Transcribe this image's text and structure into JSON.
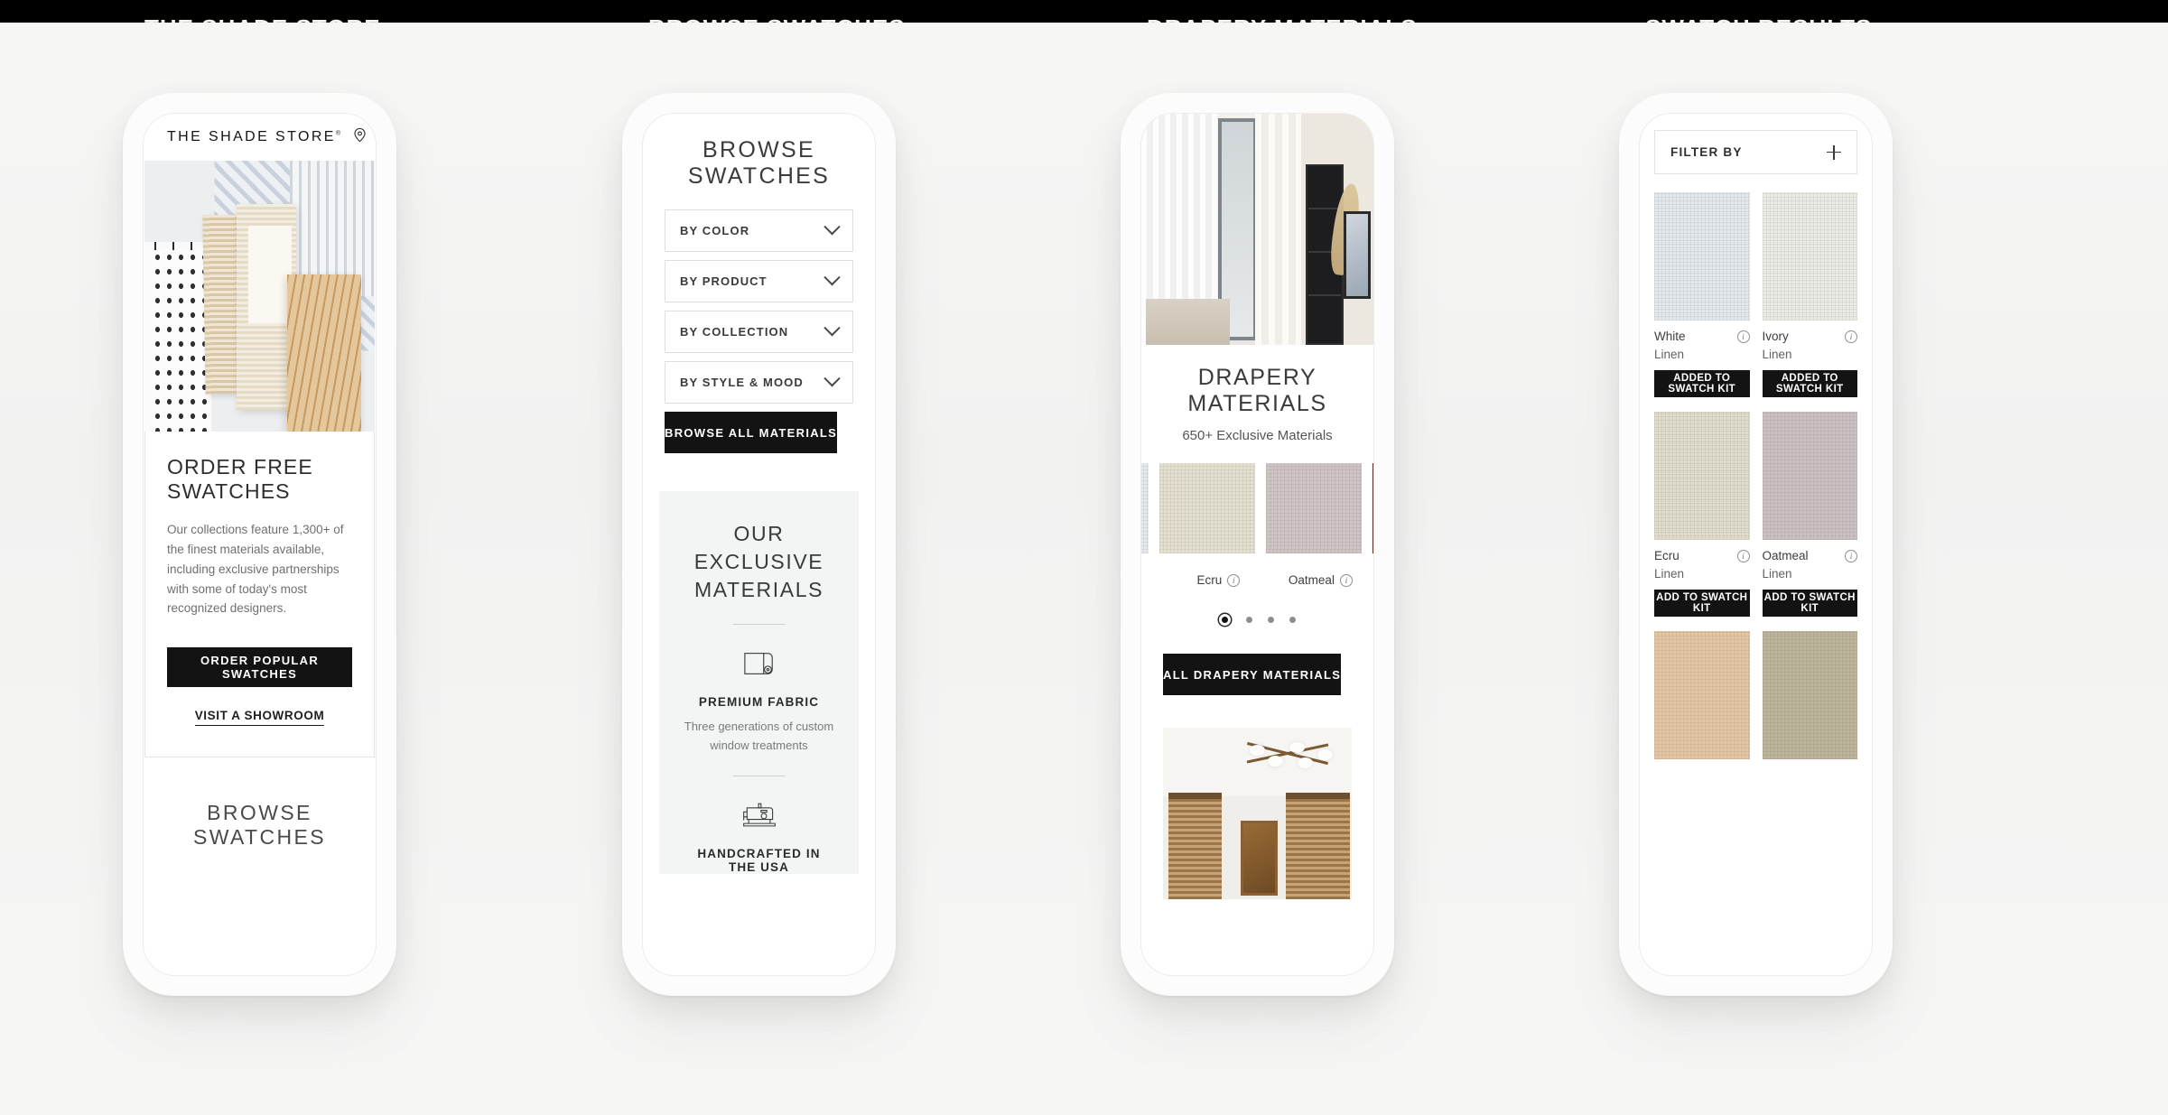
{
  "page": {
    "background_color": "#f4f4f3",
    "top_band_color": "#000000",
    "accent_dark": "#131313"
  },
  "phone1": {
    "header": {
      "menu_icon": "hamburger-icon",
      "brand": "THE SHADE STORE",
      "brand_mark": "®",
      "location_icon": "map-pin-icon",
      "cart_icon": "shopping-cart-icon"
    },
    "hero_alt": "Flat-lay of woven shade and drapery material swatches",
    "card": {
      "title": "ORDER FREE SWATCHES",
      "body": "Our collections feature 1,300+ of the finest materials available, including exclusive partnerships with some of today's most recognized designers.",
      "primary_button": "ORDER POPULAR SWATCHES",
      "secondary_link": "VISIT A SHOWROOM"
    },
    "footer_heading": "BROWSE SWATCHES"
  },
  "phone2": {
    "title": "BROWSE SWATCHES",
    "selects": [
      {
        "label": "BY COLOR",
        "icon": "chevron-down-icon"
      },
      {
        "label": "BY PRODUCT",
        "icon": "chevron-down-icon"
      },
      {
        "label": "BY COLLECTION",
        "icon": "chevron-down-icon"
      },
      {
        "label": "BY STYLE & MOOD",
        "icon": "chevron-down-icon"
      }
    ],
    "browse_all_button": "BROWSE ALL MATERIALS",
    "exclusive": {
      "heading": "OUR EXCLUSIVE MATERIALS",
      "features": [
        {
          "icon": "fabric-roll-icon",
          "name": "PREMIUM FABRIC",
          "desc": "Three generations of custom window treatments"
        },
        {
          "icon": "sewing-machine-icon",
          "name": "HANDCRAFTED IN THE USA",
          "desc": ""
        }
      ]
    }
  },
  "phone3": {
    "hero_alt": "Living room with sheer white drapery beside a glass door",
    "title": "DRAPERY MATERIALS",
    "subtitle": "650+ Exclusive Materials",
    "carousel": {
      "edge_left_color": "#e4e8ec",
      "edge_right_color": "#5a2d22",
      "items": [
        {
          "name": "Ecru",
          "color": "#e4e0cf",
          "info_icon": "info-icon"
        },
        {
          "name": "Oatmeal",
          "color": "#cdc4c3",
          "info_icon": "info-icon"
        }
      ],
      "dots": 4,
      "active_dot": 1
    },
    "cta_button": "ALL DRAPERY MATERIALS",
    "room_alt": "Room with wood blinds, artwork and sputnik ceiling light"
  },
  "phone4": {
    "filter": {
      "label": "FILTER BY",
      "icon": "plus-icon"
    },
    "swatches": [
      {
        "name": "White",
        "material": "Linen",
        "color": "#e1e7ec",
        "button": "ADDED TO SWATCH KIT",
        "added": true,
        "info_icon": "info-icon"
      },
      {
        "name": "Ivory",
        "material": "Linen",
        "color": "#e8eae3",
        "button": "ADDED TO SWATCH KIT",
        "added": true,
        "info_icon": "info-icon"
      },
      {
        "name": "Ecru",
        "material": "Linen",
        "color": "#dfdccb",
        "button": "ADD TO SWATCH KIT",
        "added": false,
        "info_icon": "info-icon"
      },
      {
        "name": "Oatmeal",
        "material": "Linen",
        "color": "#cbc0c2",
        "button": "ADD TO SWATCH KIT",
        "added": false,
        "info_icon": "info-icon"
      },
      {
        "name": "",
        "material": "",
        "color": "#e2c5a2",
        "button": "",
        "added": false,
        "info_icon": ""
      },
      {
        "name": "",
        "material": "",
        "color": "#bdb49c",
        "button": "",
        "added": false,
        "info_icon": ""
      }
    ]
  }
}
